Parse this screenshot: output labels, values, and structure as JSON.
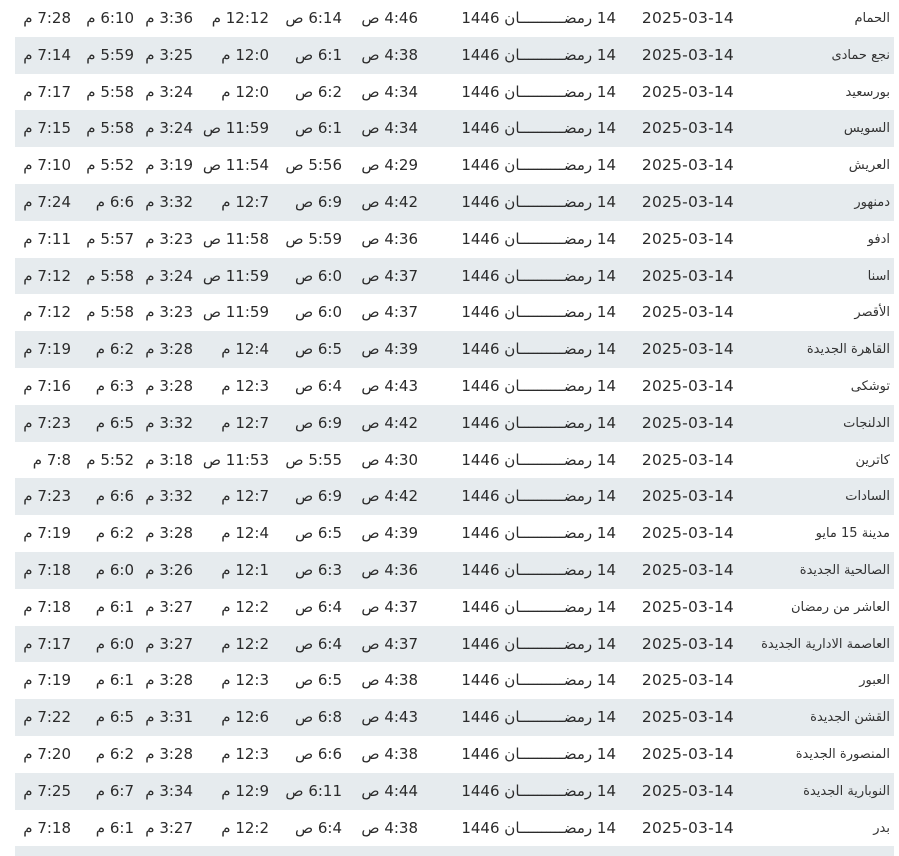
{
  "rows": [
    {
      "city": "الحمام",
      "date": "2025-03-14",
      "hijri_day": "14",
      "hijri_month": "رمضــــــــــان",
      "hijri_year": "1446",
      "fajr": "4:46 ص",
      "shuruq": "6:14 ص",
      "dhuhr": "12:12 م",
      "asr": "3:36 م",
      "maghrib": "6:10 م",
      "isha": "7:28 م"
    },
    {
      "city": "نجع حمادى",
      "date": "2025-03-14",
      "hijri_day": "14",
      "hijri_month": "رمضــــــــــان",
      "hijri_year": "1446",
      "fajr": "4:38 ص",
      "shuruq": "6:1 ص",
      "dhuhr": "12:0 م",
      "asr": "3:25 م",
      "maghrib": "5:59 م",
      "isha": "7:14 م"
    },
    {
      "city": "بورسعيد",
      "date": "2025-03-14",
      "hijri_day": "14",
      "hijri_month": "رمضــــــــــان",
      "hijri_year": "1446",
      "fajr": "4:34 ص",
      "shuruq": "6:2 ص",
      "dhuhr": "12:0 م",
      "asr": "3:24 م",
      "maghrib": "5:58 م",
      "isha": "7:17 م"
    },
    {
      "city": "السويس",
      "date": "2025-03-14",
      "hijri_day": "14",
      "hijri_month": "رمضــــــــــان",
      "hijri_year": "1446",
      "fajr": "4:34 ص",
      "shuruq": "6:1 ص",
      "dhuhr": "11:59 ص",
      "asr": "3:24 م",
      "maghrib": "5:58 م",
      "isha": "7:15 م"
    },
    {
      "city": "العريش",
      "date": "2025-03-14",
      "hijri_day": "14",
      "hijri_month": "رمضــــــــــان",
      "hijri_year": "1446",
      "fajr": "4:29 ص",
      "shuruq": "5:56 ص",
      "dhuhr": "11:54 ص",
      "asr": "3:19 م",
      "maghrib": "5:52 م",
      "isha": "7:10 م"
    },
    {
      "city": "دمنهور",
      "date": "2025-03-14",
      "hijri_day": "14",
      "hijri_month": "رمضــــــــــان",
      "hijri_year": "1446",
      "fajr": "4:42 ص",
      "shuruq": "6:9 ص",
      "dhuhr": "12:7 م",
      "asr": "3:32 م",
      "maghrib": "6:6 م",
      "isha": "7:24 م"
    },
    {
      "city": "ادفو",
      "date": "2025-03-14",
      "hijri_day": "14",
      "hijri_month": "رمضــــــــــان",
      "hijri_year": "1446",
      "fajr": "4:36 ص",
      "shuruq": "5:59 ص",
      "dhuhr": "11:58 ص",
      "asr": "3:23 م",
      "maghrib": "5:57 م",
      "isha": "7:11 م"
    },
    {
      "city": "اسنا",
      "date": "2025-03-14",
      "hijri_day": "14",
      "hijri_month": "رمضــــــــــان",
      "hijri_year": "1446",
      "fajr": "4:37 ص",
      "shuruq": "6:0 ص",
      "dhuhr": "11:59 ص",
      "asr": "3:24 م",
      "maghrib": "5:58 م",
      "isha": "7:12 م"
    },
    {
      "city": "الأقصر",
      "date": "2025-03-14",
      "hijri_day": "14",
      "hijri_month": "رمضــــــــــان",
      "hijri_year": "1446",
      "fajr": "4:37 ص",
      "shuruq": "6:0 ص",
      "dhuhr": "11:59 ص",
      "asr": "3:23 م",
      "maghrib": "5:58 م",
      "isha": "7:12 م"
    },
    {
      "city": "القاهرة الجديدة",
      "date": "2025-03-14",
      "hijri_day": "14",
      "hijri_month": "رمضــــــــــان",
      "hijri_year": "1446",
      "fajr": "4:39 ص",
      "shuruq": "6:5 ص",
      "dhuhr": "12:4 م",
      "asr": "3:28 م",
      "maghrib": "6:2 م",
      "isha": "7:19 م"
    },
    {
      "city": "توشكى",
      "date": "2025-03-14",
      "hijri_day": "14",
      "hijri_month": "رمضــــــــــان",
      "hijri_year": "1446",
      "fajr": "4:43 ص",
      "shuruq": "6:4 ص",
      "dhuhr": "12:3 م",
      "asr": "3:28 م",
      "maghrib": "6:3 م",
      "isha": "7:16 م"
    },
    {
      "city": "الدلنجات",
      "date": "2025-03-14",
      "hijri_day": "14",
      "hijri_month": "رمضــــــــــان",
      "hijri_year": "1446",
      "fajr": "4:42 ص",
      "shuruq": "6:9 ص",
      "dhuhr": "12:7 م",
      "asr": "3:32 م",
      "maghrib": "6:5 م",
      "isha": "7:23 م"
    },
    {
      "city": "كاترين",
      "date": "2025-03-14",
      "hijri_day": "14",
      "hijri_month": "رمضــــــــــان",
      "hijri_year": "1446",
      "fajr": "4:30 ص",
      "shuruq": "5:55 ص",
      "dhuhr": "11:53 ص",
      "asr": "3:18 م",
      "maghrib": "5:52 م",
      "isha": "7:8 م"
    },
    {
      "city": "السادات",
      "date": "2025-03-14",
      "hijri_day": "14",
      "hijri_month": "رمضــــــــــان",
      "hijri_year": "1446",
      "fajr": "4:42 ص",
      "shuruq": "6:9 ص",
      "dhuhr": "12:7 م",
      "asr": "3:32 م",
      "maghrib": "6:6 م",
      "isha": "7:23 م"
    },
    {
      "city": "مدينة 15 مايو",
      "date": "2025-03-14",
      "hijri_day": "14",
      "hijri_month": "رمضــــــــــان",
      "hijri_year": "1446",
      "fajr": "4:39 ص",
      "shuruq": "6:5 ص",
      "dhuhr": "12:4 م",
      "asr": "3:28 م",
      "maghrib": "6:2 م",
      "isha": "7:19 م"
    },
    {
      "city": "الصالحية الجديدة",
      "date": "2025-03-14",
      "hijri_day": "14",
      "hijri_month": "رمضــــــــــان",
      "hijri_year": "1446",
      "fajr": "4:36 ص",
      "shuruq": "6:3 ص",
      "dhuhr": "12:1 م",
      "asr": "3:26 م",
      "maghrib": "6:0 م",
      "isha": "7:18 م"
    },
    {
      "city": "العاشر من رمضان",
      "date": "2025-03-14",
      "hijri_day": "14",
      "hijri_month": "رمضــــــــــان",
      "hijri_year": "1446",
      "fajr": "4:37 ص",
      "shuruq": "6:4 ص",
      "dhuhr": "12:2 م",
      "asr": "3:27 م",
      "maghrib": "6:1 م",
      "isha": "7:18 م"
    },
    {
      "city": "العاصمة الادارية الجديدة",
      "date": "2025-03-14",
      "hijri_day": "14",
      "hijri_month": "رمضــــــــــان",
      "hijri_year": "1446",
      "fajr": "4:37 ص",
      "shuruq": "6:4 ص",
      "dhuhr": "12:2 م",
      "asr": "3:27 م",
      "maghrib": "6:0 م",
      "isha": "7:17 م"
    },
    {
      "city": "العبور",
      "date": "2025-03-14",
      "hijri_day": "14",
      "hijri_month": "رمضــــــــــان",
      "hijri_year": "1446",
      "fajr": "4:38 ص",
      "shuruq": "6:5 ص",
      "dhuhr": "12:3 م",
      "asr": "3:28 م",
      "maghrib": "6:1 م",
      "isha": "7:19 م"
    },
    {
      "city": "القشن الجديدة",
      "date": "2025-03-14",
      "hijri_day": "14",
      "hijri_month": "رمضــــــــــان",
      "hijri_year": "1446",
      "fajr": "4:43 ص",
      "shuruq": "6:8 ص",
      "dhuhr": "12:6 م",
      "asr": "3:31 م",
      "maghrib": "6:5 م",
      "isha": "7:22 م"
    },
    {
      "city": "المنصورة الجديدة",
      "date": "2025-03-14",
      "hijri_day": "14",
      "hijri_month": "رمضــــــــــان",
      "hijri_year": "1446",
      "fajr": "4:38 ص",
      "shuruq": "6:6 ص",
      "dhuhr": "12:3 م",
      "asr": "3:28 م",
      "maghrib": "6:2 م",
      "isha": "7:20 م"
    },
    {
      "city": "النوبارية الجديدة",
      "date": "2025-03-14",
      "hijri_day": "14",
      "hijri_month": "رمضــــــــــان",
      "hijri_year": "1446",
      "fajr": "4:44 ص",
      "shuruq": "6:11 ص",
      "dhuhr": "12:9 م",
      "asr": "3:34 م",
      "maghrib": "6:7 م",
      "isha": "7:25 م"
    },
    {
      "city": "بدر",
      "date": "2025-03-14",
      "hijri_day": "14",
      "hijri_month": "رمضــــــــــان",
      "hijri_year": "1446",
      "fajr": "4:38 ص",
      "shuruq": "6:4 ص",
      "dhuhr": "12:2 م",
      "asr": "3:27 م",
      "maghrib": "6:1 م",
      "isha": "7:18 م"
    }
  ]
}
